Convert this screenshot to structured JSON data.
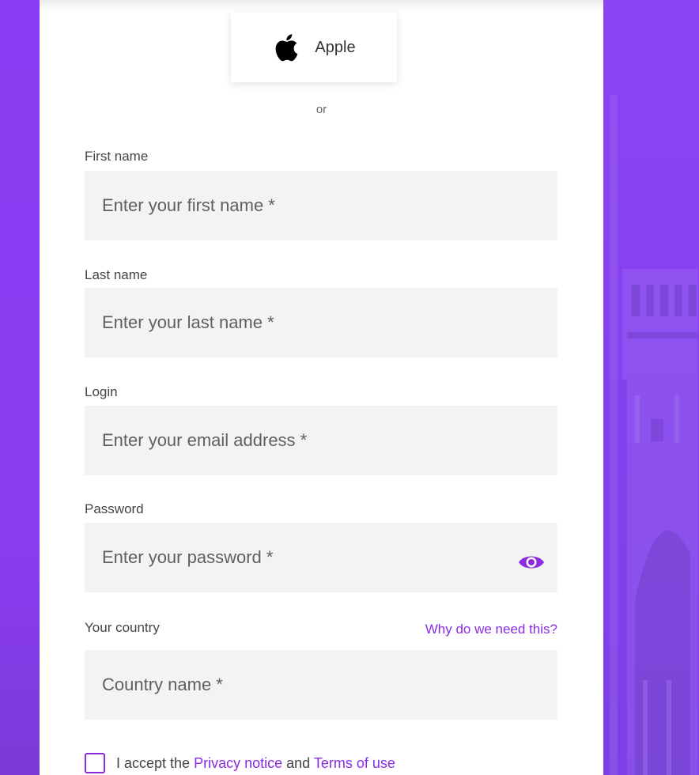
{
  "apple_button": {
    "label": "Apple",
    "icon": "apple-icon"
  },
  "separator": "or",
  "fields": {
    "first_name": {
      "label": "First name",
      "placeholder": "Enter your first name *",
      "value": ""
    },
    "last_name": {
      "label": "Last name",
      "placeholder": "Enter your last name *",
      "value": ""
    },
    "login": {
      "label": "Login",
      "placeholder": "Enter your email address *",
      "value": ""
    },
    "password": {
      "label": "Password",
      "placeholder": "Enter your password *",
      "value": "",
      "toggle_icon": "eye-icon"
    },
    "country": {
      "label": "Your country",
      "placeholder": "Country name *",
      "value": "",
      "help_link": "Why do we need this?"
    }
  },
  "consent": {
    "prefix": "I accept the",
    "privacy_link": "Privacy notice",
    "middle": "and",
    "terms_link": "Terms of use",
    "checked": false
  },
  "colors": {
    "accent": "#8a2be2",
    "background": "#8a3cf0",
    "input_bg": "#f3f3f3"
  }
}
